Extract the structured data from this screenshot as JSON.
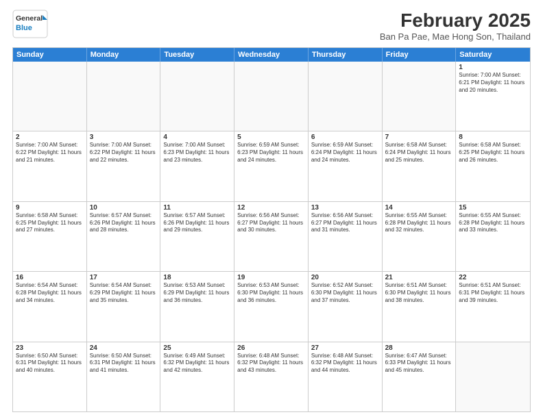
{
  "header": {
    "logo_line1": "General",
    "logo_line2": "Blue",
    "title": "February 2025",
    "subtitle": "Ban Pa Pae, Mae Hong Son, Thailand"
  },
  "days_of_week": [
    "Sunday",
    "Monday",
    "Tuesday",
    "Wednesday",
    "Thursday",
    "Friday",
    "Saturday"
  ],
  "weeks": [
    [
      {
        "day": "",
        "info": ""
      },
      {
        "day": "",
        "info": ""
      },
      {
        "day": "",
        "info": ""
      },
      {
        "day": "",
        "info": ""
      },
      {
        "day": "",
        "info": ""
      },
      {
        "day": "",
        "info": ""
      },
      {
        "day": "1",
        "info": "Sunrise: 7:00 AM\nSunset: 6:21 PM\nDaylight: 11 hours\nand 20 minutes."
      }
    ],
    [
      {
        "day": "2",
        "info": "Sunrise: 7:00 AM\nSunset: 6:22 PM\nDaylight: 11 hours\nand 21 minutes."
      },
      {
        "day": "3",
        "info": "Sunrise: 7:00 AM\nSunset: 6:22 PM\nDaylight: 11 hours\nand 22 minutes."
      },
      {
        "day": "4",
        "info": "Sunrise: 7:00 AM\nSunset: 6:23 PM\nDaylight: 11 hours\nand 23 minutes."
      },
      {
        "day": "5",
        "info": "Sunrise: 6:59 AM\nSunset: 6:23 PM\nDaylight: 11 hours\nand 24 minutes."
      },
      {
        "day": "6",
        "info": "Sunrise: 6:59 AM\nSunset: 6:24 PM\nDaylight: 11 hours\nand 24 minutes."
      },
      {
        "day": "7",
        "info": "Sunrise: 6:58 AM\nSunset: 6:24 PM\nDaylight: 11 hours\nand 25 minutes."
      },
      {
        "day": "8",
        "info": "Sunrise: 6:58 AM\nSunset: 6:25 PM\nDaylight: 11 hours\nand 26 minutes."
      }
    ],
    [
      {
        "day": "9",
        "info": "Sunrise: 6:58 AM\nSunset: 6:25 PM\nDaylight: 11 hours\nand 27 minutes."
      },
      {
        "day": "10",
        "info": "Sunrise: 6:57 AM\nSunset: 6:26 PM\nDaylight: 11 hours\nand 28 minutes."
      },
      {
        "day": "11",
        "info": "Sunrise: 6:57 AM\nSunset: 6:26 PM\nDaylight: 11 hours\nand 29 minutes."
      },
      {
        "day": "12",
        "info": "Sunrise: 6:56 AM\nSunset: 6:27 PM\nDaylight: 11 hours\nand 30 minutes."
      },
      {
        "day": "13",
        "info": "Sunrise: 6:56 AM\nSunset: 6:27 PM\nDaylight: 11 hours\nand 31 minutes."
      },
      {
        "day": "14",
        "info": "Sunrise: 6:55 AM\nSunset: 6:28 PM\nDaylight: 11 hours\nand 32 minutes."
      },
      {
        "day": "15",
        "info": "Sunrise: 6:55 AM\nSunset: 6:28 PM\nDaylight: 11 hours\nand 33 minutes."
      }
    ],
    [
      {
        "day": "16",
        "info": "Sunrise: 6:54 AM\nSunset: 6:28 PM\nDaylight: 11 hours\nand 34 minutes."
      },
      {
        "day": "17",
        "info": "Sunrise: 6:54 AM\nSunset: 6:29 PM\nDaylight: 11 hours\nand 35 minutes."
      },
      {
        "day": "18",
        "info": "Sunrise: 6:53 AM\nSunset: 6:29 PM\nDaylight: 11 hours\nand 36 minutes."
      },
      {
        "day": "19",
        "info": "Sunrise: 6:53 AM\nSunset: 6:30 PM\nDaylight: 11 hours\nand 36 minutes."
      },
      {
        "day": "20",
        "info": "Sunrise: 6:52 AM\nSunset: 6:30 PM\nDaylight: 11 hours\nand 37 minutes."
      },
      {
        "day": "21",
        "info": "Sunrise: 6:51 AM\nSunset: 6:30 PM\nDaylight: 11 hours\nand 38 minutes."
      },
      {
        "day": "22",
        "info": "Sunrise: 6:51 AM\nSunset: 6:31 PM\nDaylight: 11 hours\nand 39 minutes."
      }
    ],
    [
      {
        "day": "23",
        "info": "Sunrise: 6:50 AM\nSunset: 6:31 PM\nDaylight: 11 hours\nand 40 minutes."
      },
      {
        "day": "24",
        "info": "Sunrise: 6:50 AM\nSunset: 6:31 PM\nDaylight: 11 hours\nand 41 minutes."
      },
      {
        "day": "25",
        "info": "Sunrise: 6:49 AM\nSunset: 6:32 PM\nDaylight: 11 hours\nand 42 minutes."
      },
      {
        "day": "26",
        "info": "Sunrise: 6:48 AM\nSunset: 6:32 PM\nDaylight: 11 hours\nand 43 minutes."
      },
      {
        "day": "27",
        "info": "Sunrise: 6:48 AM\nSunset: 6:32 PM\nDaylight: 11 hours\nand 44 minutes."
      },
      {
        "day": "28",
        "info": "Sunrise: 6:47 AM\nSunset: 6:33 PM\nDaylight: 11 hours\nand 45 minutes."
      },
      {
        "day": "",
        "info": ""
      }
    ]
  ]
}
